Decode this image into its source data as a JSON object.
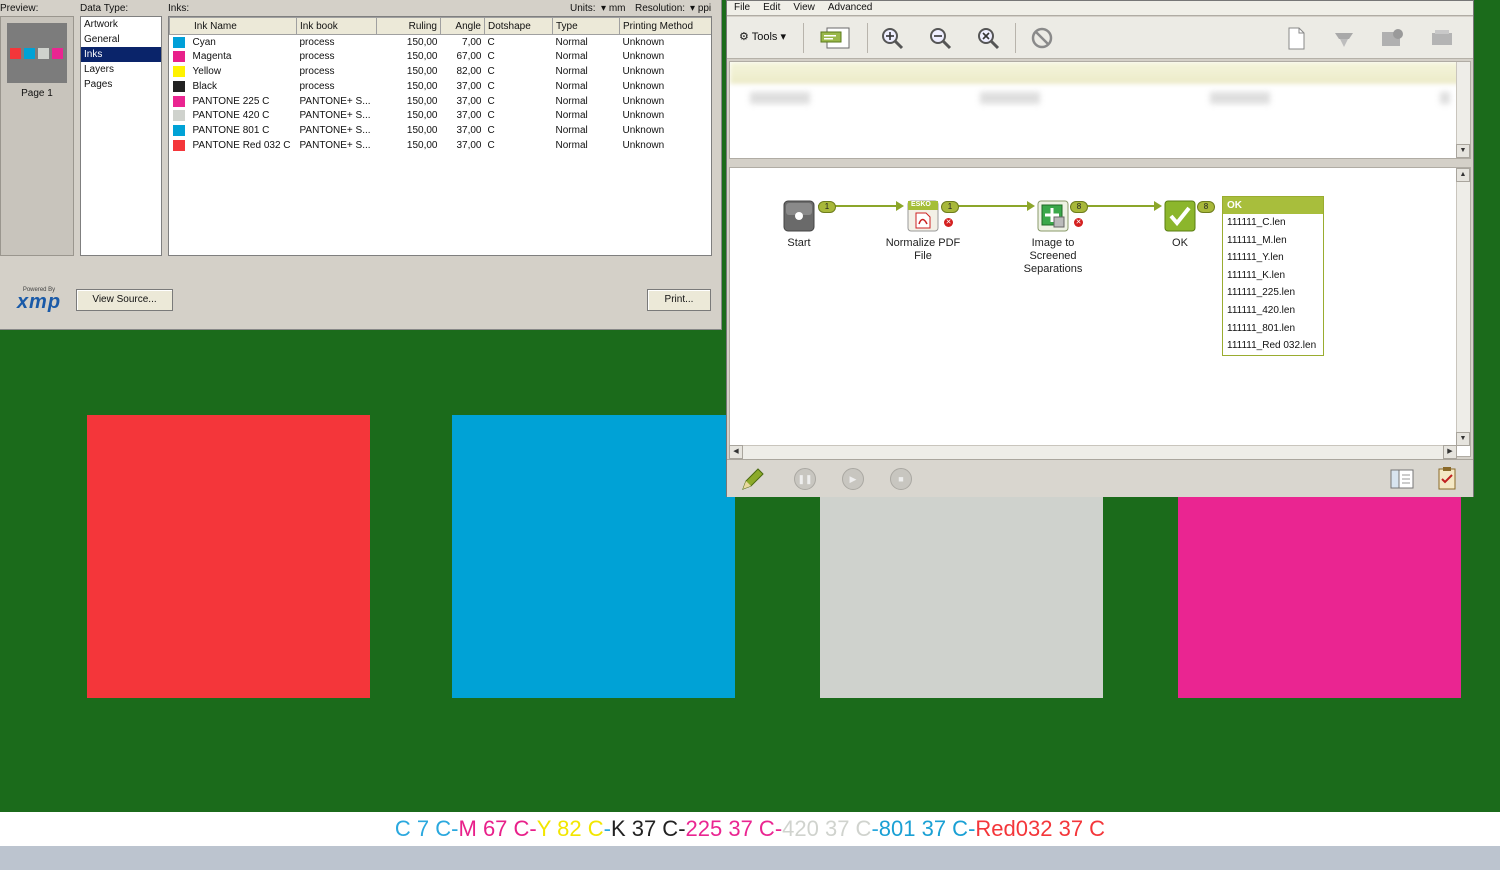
{
  "xmp_panel": {
    "preview_label": "Preview:",
    "datatype_label": "Data Type:",
    "inks_label": "Inks:",
    "units_label": "Units:",
    "units_value": "mm",
    "resolution_label": "Resolution:",
    "resolution_value": "ppi",
    "page_label": "Page 1",
    "data_types": [
      "Artwork",
      "General",
      "Inks",
      "Layers",
      "Pages"
    ],
    "selected_data_type": "Inks",
    "columns": [
      "Ink Name",
      "Ink book",
      "Ruling",
      "Angle",
      "Dotshape",
      "Type",
      "Printing Method"
    ],
    "inks": [
      {
        "name": "Cyan",
        "book": "process",
        "ruling": "150,00",
        "angle": "7,00",
        "dot": "C",
        "type": "Normal",
        "method": "Unknown",
        "color": "#00a0d8"
      },
      {
        "name": "Magenta",
        "book": "process",
        "ruling": "150,00",
        "angle": "67,00",
        "dot": "C",
        "type": "Normal",
        "method": "Unknown",
        "color": "#e8208a"
      },
      {
        "name": "Yellow",
        "book": "process",
        "ruling": "150,00",
        "angle": "82,00",
        "dot": "C",
        "type": "Normal",
        "method": "Unknown",
        "color": "#fff200"
      },
      {
        "name": "Black",
        "book": "process",
        "ruling": "150,00",
        "angle": "37,00",
        "dot": "C",
        "type": "Normal",
        "method": "Unknown",
        "color": "#222222"
      },
      {
        "name": "PANTONE 225 C",
        "book": "PANTONE+ S...",
        "ruling": "150,00",
        "angle": "37,00",
        "dot": "C",
        "type": "Normal",
        "method": "Unknown",
        "color": "#ea2591"
      },
      {
        "name": "PANTONE 420 C",
        "book": "PANTONE+ S...",
        "ruling": "150,00",
        "angle": "37,00",
        "dot": "C",
        "type": "Normal",
        "method": "Unknown",
        "color": "#cfd2cd"
      },
      {
        "name": "PANTONE 801 C",
        "book": "PANTONE+ S...",
        "ruling": "150,00",
        "angle": "37,00",
        "dot": "C",
        "type": "Normal",
        "method": "Unknown",
        "color": "#00a2d6"
      },
      {
        "name": "PANTONE Red 032 C",
        "book": "PANTONE+ S...",
        "ruling": "150,00",
        "angle": "37,00",
        "dot": "C",
        "type": "Normal",
        "method": "Unknown",
        "color": "#f4363a"
      }
    ],
    "view_source_label": "View Source...",
    "print_label": "Print...",
    "xmp_powered": "Powered By",
    "xmp_logo_text": "xmp"
  },
  "workflow": {
    "menu": [
      "File",
      "Edit",
      "View",
      "Advanced"
    ],
    "tools_label": "Tools",
    "nodes": {
      "start": "Start",
      "normalize": "Normalize PDF File",
      "screen": "Image to Screened Separations",
      "ok": "OK"
    },
    "esko_label": "ESKO",
    "badges": [
      "1",
      "1",
      "8",
      "8"
    ],
    "ok_list_header": "OK",
    "ok_files": [
      "111111_C.len",
      "111111_M.len",
      "111111_Y.len",
      "111111_K.len",
      "111111_225.len",
      "111111_420.len",
      "111111_801.len",
      "111111_Red 032.len"
    ]
  },
  "artwork": {
    "swatches": [
      {
        "color": "#f4363a"
      },
      {
        "color": "#00a2d6"
      },
      {
        "color": "#cfd2cd"
      },
      {
        "color": "#ea2591"
      }
    ],
    "caption": [
      {
        "text": "C 7 C",
        "color": "#2aa8de"
      },
      {
        "text": "-",
        "color": "#2aa8de"
      },
      {
        "text": "M 67 C",
        "color": "#e8208a"
      },
      {
        "text": "-",
        "color": "#e8208a"
      },
      {
        "text": "Y 82 C",
        "color": "#f2e600"
      },
      {
        "text": "-",
        "color": "#2aa8de"
      },
      {
        "text": "K 37 C",
        "color": "#222222"
      },
      {
        "text": "-",
        "color": "#222222"
      },
      {
        "text": "225 37 C",
        "color": "#ea2591"
      },
      {
        "text": "-",
        "color": "#ea2591"
      },
      {
        "text": "420 37 C",
        "color": "#d0d3ce"
      },
      {
        "text": "-",
        "color": "#2aa8de"
      },
      {
        "text": "801 37 C",
        "color": "#1aa0d4"
      },
      {
        "text": "-",
        "color": "#1aa0d4"
      },
      {
        "text": "Red032 37 C",
        "color": "#f4363a"
      }
    ]
  }
}
